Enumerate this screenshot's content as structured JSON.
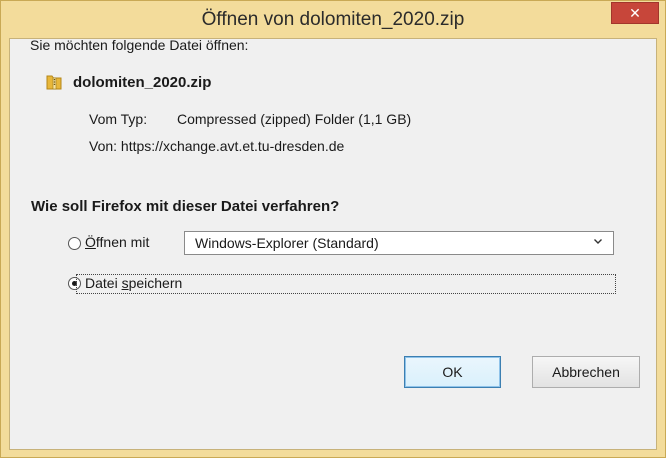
{
  "window": {
    "title": "Öffnen von dolomiten_2020.zip",
    "close_glyph": "✕"
  },
  "dialog": {
    "intro": "Sie möchten folgende Datei öffnen:",
    "file_icon": "zip-folder-icon",
    "file_name": "dolomiten_2020.zip",
    "type_label": "Vom Typ:",
    "type_value": "Compressed (zipped) Folder (1,1 GB)",
    "from_label": "Von:",
    "from_value": "https://xchange.avt.et.tu-dresden.de",
    "question": "Wie soll Firefox mit dieser Datei verfahren?",
    "options": {
      "open_with": {
        "label_accel": "Ö",
        "label_rest": "ffnen mit",
        "selected": false
      },
      "save_file": {
        "label_pre": "Datei ",
        "label_accel": "s",
        "label_rest": "peichern",
        "selected": true
      }
    },
    "app_select": {
      "value": "Windows-Explorer (Standard)",
      "chevron": "⌄"
    }
  },
  "buttons": {
    "ok": "OK",
    "cancel": "Abbrechen"
  },
  "colors": {
    "frame": "#f3dc9b",
    "close": "#c7463a",
    "client": "#f0f0f0"
  }
}
